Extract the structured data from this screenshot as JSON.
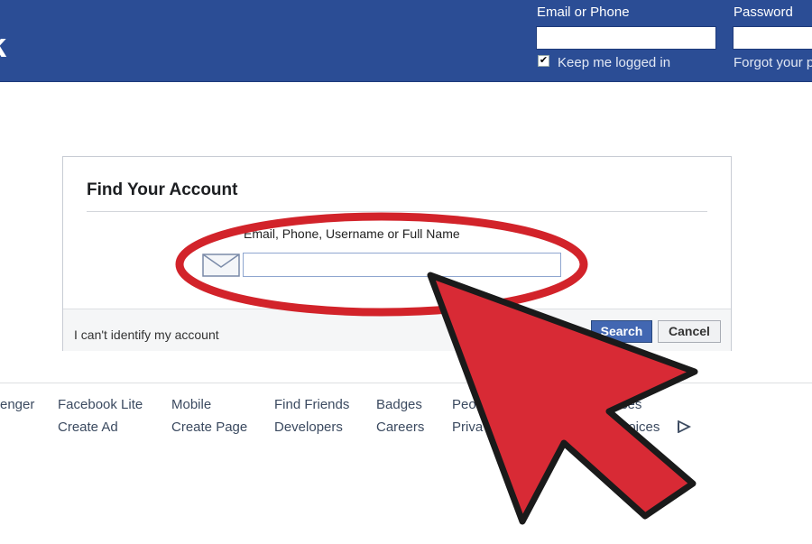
{
  "header": {
    "logo_fragment": "k",
    "email_label": "Email or Phone",
    "password_label": "Password",
    "keep_logged_in": "Keep me logged in",
    "keep_checked_mark": "✔",
    "forgot_link": "Forgot your p"
  },
  "card": {
    "title": "Find Your Account",
    "field_label": "Email, Phone, Username or Full Name",
    "field_value": "",
    "cant_identify": "I can't identify my account",
    "search_button": "Search",
    "cancel_button": "Cancel"
  },
  "footer": {
    "row1": [
      "enger",
      "Facebook Lite",
      "Mobile",
      "Find Friends",
      "Badges",
      "Peo",
      "ces"
    ],
    "row2": [
      "Create Ad",
      "Create Page",
      "Developers",
      "Careers",
      "Priva",
      "hoices"
    ]
  },
  "colors": {
    "brand_blue": "#2b4d95",
    "button_blue": "#4267b2",
    "annotation_red": "#d2232a"
  },
  "icons": {
    "field_icon": "envelope-icon",
    "adchoices_icon": "adchoices-icon",
    "annotation": "red-arrow-pointer"
  }
}
